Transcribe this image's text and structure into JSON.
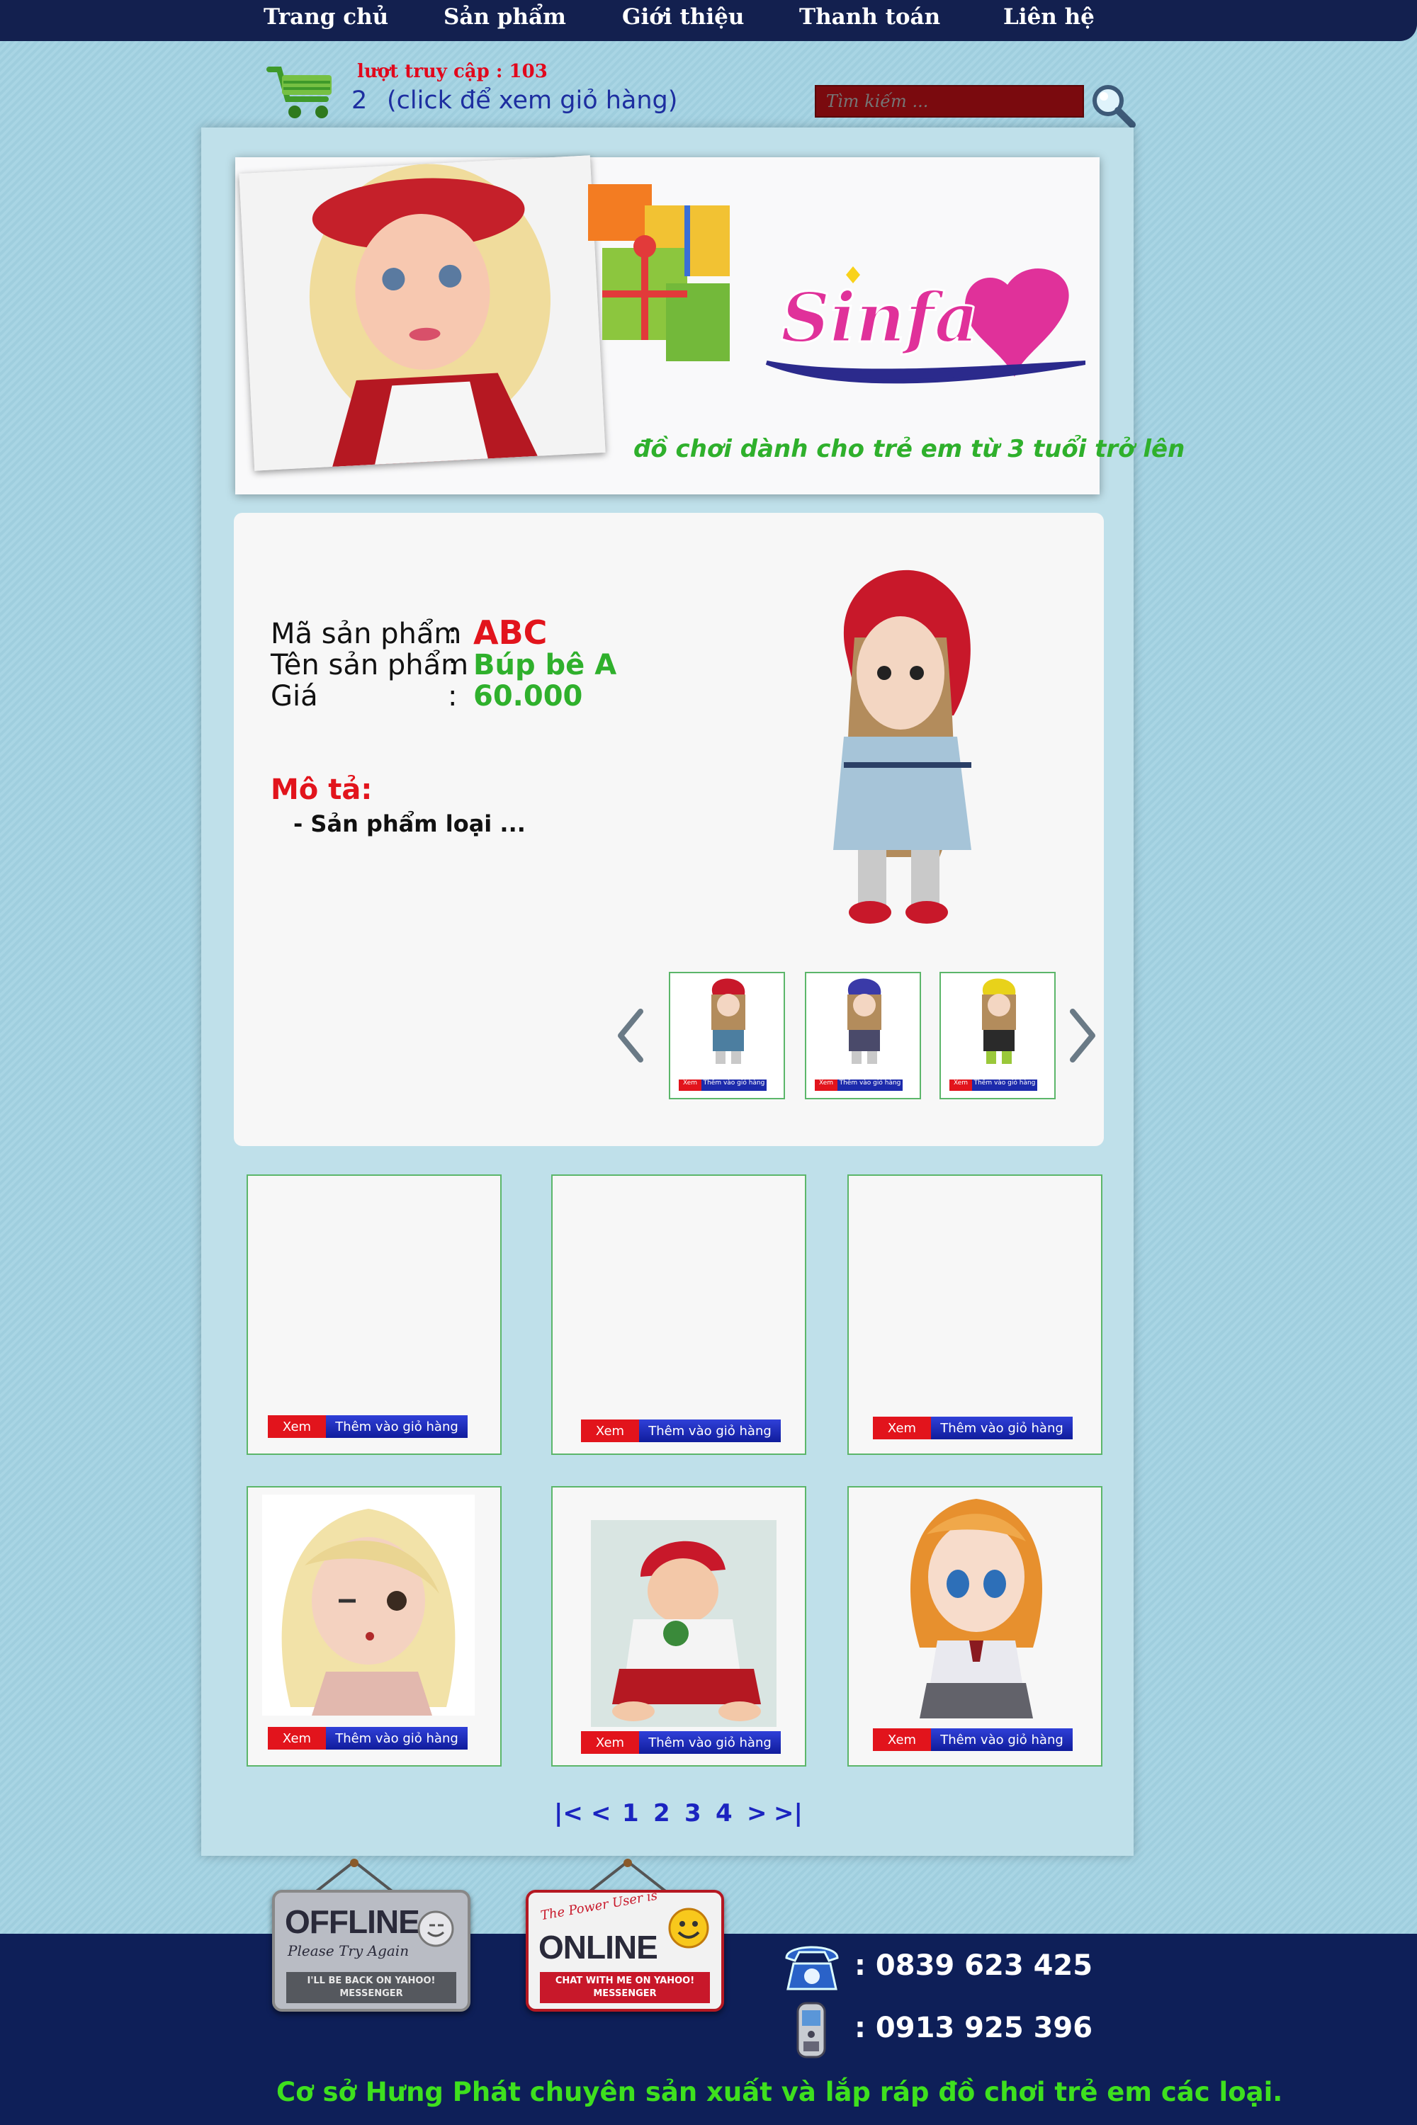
{
  "nav": {
    "items": [
      "Trang chủ",
      "Sản phẩm",
      "Giới thiệu",
      "Thanh toán",
      "Liên hệ"
    ]
  },
  "cart": {
    "visits": "lượt truy cập : 103",
    "count": "2",
    "link": "(click để xem giỏ hàng)"
  },
  "search": {
    "placeholder": "Tìm kiếm ..."
  },
  "banner": {
    "logo": "Sinfa",
    "tagline": "đồ chơi dành cho trẻ em từ 3 tuổi trở lên"
  },
  "product": {
    "code_label": "Mã sản phẩm",
    "code": "ABC",
    "name_label": "Tên sản phẩm",
    "name": "Búp bê A",
    "price_label": "Giá",
    "price": "60.000",
    "colon": ":",
    "desc_label": "Mô tả:",
    "desc": "- Sản phẩm loại ..."
  },
  "thumbs": {
    "view": "Xem",
    "add": "Thêm vào giỏ hàng"
  },
  "cards": {
    "view": "Xem",
    "add": "Thêm vào giỏ hàng"
  },
  "pager": {
    "first": "|<",
    "prev": "<",
    "pages": [
      "1",
      "2",
      "3",
      "4"
    ],
    "next": ">",
    "last": ">|"
  },
  "footer": {
    "offline_title": "OFFLINE",
    "offline_sub": "Please Try Again",
    "offline_note": "I'LL BE BACK ON YAHOO! MESSENGER",
    "online_top": "The Power User is",
    "online_title": "ONLINE",
    "online_note": "CHAT WITH ME ON YAHOO! MESSENGER",
    "phone1": ":  0839 623 425",
    "phone2": ":  0913 925 396",
    "slogan": "Cơ sở Hưng Phát chuyên sản xuất và lắp ráp đồ chơi trẻ em các loại."
  },
  "colors": {
    "nav_bg": "#13204f",
    "accent_red": "#e2141c",
    "accent_green": "#2fb02c",
    "button_blue": "#1c2aac",
    "footer_bg": "#0e1f58"
  }
}
